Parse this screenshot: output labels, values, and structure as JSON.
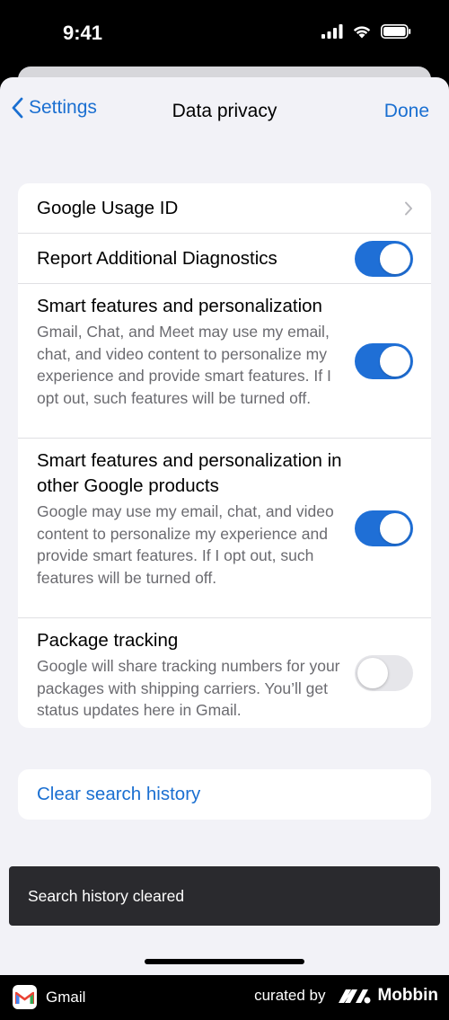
{
  "status": {
    "time": "9:41"
  },
  "nav": {
    "back_label": "Settings",
    "title": "Data privacy",
    "done_label": "Done"
  },
  "settings": {
    "usage_id": {
      "title": "Google Usage ID"
    },
    "diagnostics": {
      "title": "Report Additional Diagnostics",
      "enabled": true
    },
    "smart_features": {
      "title": "Smart features and personalization",
      "description": "Gmail, Chat, and Meet may use my email, chat, and video content to personalize my experience and provide smart features. If I opt out, such features will be turned off.",
      "enabled": true
    },
    "smart_features_other": {
      "title": "Smart features and personalization in other Google products",
      "description": "Google may use my email, chat, and video content to personalize my experience and provide smart features. If I opt out, such features will be turned off.",
      "enabled": true
    },
    "package_tracking": {
      "title": "Package tracking",
      "description": "Google will share tracking numbers for your packages with shipping carriers. You’ll get status updates here in Gmail.",
      "enabled": false
    }
  },
  "actions": {
    "clear_history": "Clear search history"
  },
  "toast": {
    "message": "Search history cleared"
  },
  "footer": {
    "app_name": "Gmail",
    "curated_by": "curated by",
    "brand": "Mobbin"
  },
  "colors": {
    "accent": "#1a6fd1",
    "toggle_on": "#1f6fd6",
    "toggle_off": "#e6e6ea",
    "background": "#f2f2f7"
  }
}
